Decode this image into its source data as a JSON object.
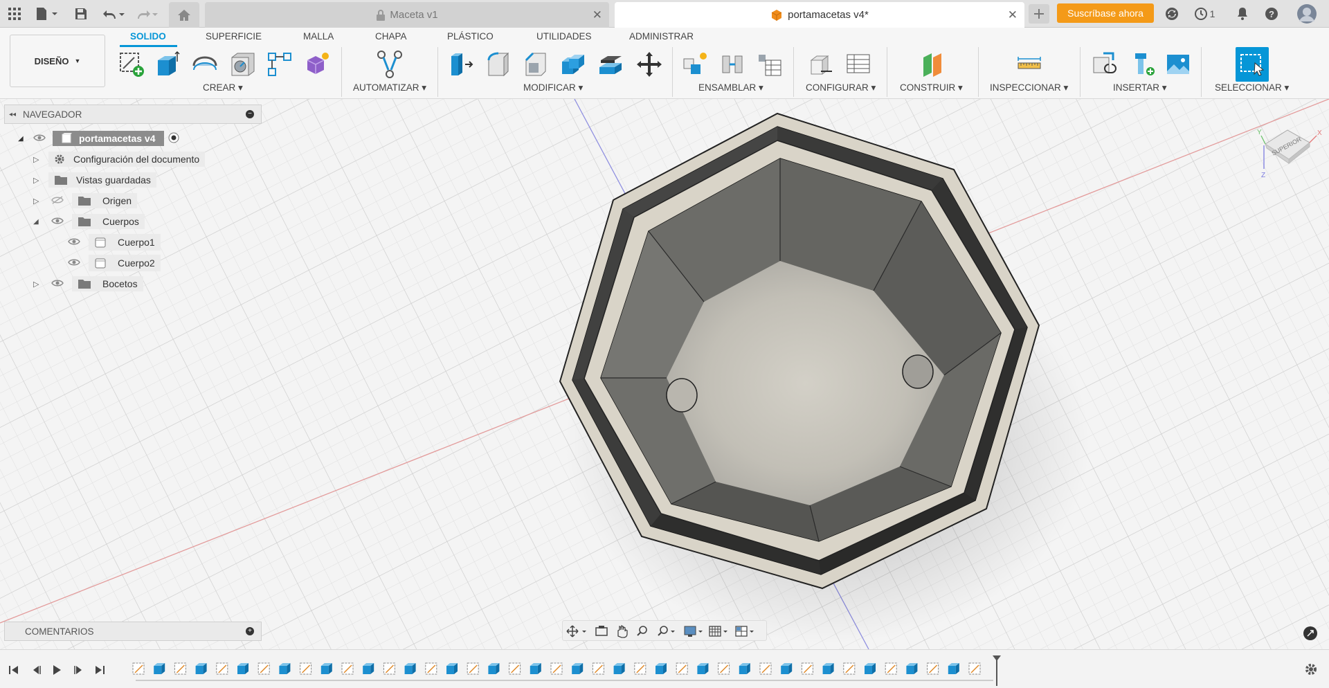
{
  "tabs": {
    "inactive": {
      "label": "Maceta v1"
    },
    "active": {
      "label": "portamacetas v4*"
    }
  },
  "header": {
    "subscribe_label": "Suscríbase ahora",
    "job_count": "1"
  },
  "toolbar": {
    "workspace_label": "DISEÑO",
    "ribbon_tabs": [
      "SOLIDO",
      "SUPERFICIE",
      "MALLA",
      "CHAPA",
      "PLÁSTICO",
      "UTILIDADES",
      "ADMINISTRAR"
    ],
    "groups": [
      "CREAR",
      "AUTOMATIZAR",
      "MODIFICAR",
      "ENSAMBLAR",
      "CONFIGURAR",
      "CONSTRUIR",
      "INSPECCIONAR",
      "INSERTAR",
      "SELECCIONAR"
    ]
  },
  "navigator": {
    "title": "NAVEGADOR",
    "root": "portamacetas v4",
    "items": [
      {
        "label": "Configuración del documento"
      },
      {
        "label": "Vistas guardadas"
      },
      {
        "label": "Origen"
      },
      {
        "label": "Cuerpos"
      },
      {
        "label": "Cuerpo1"
      },
      {
        "label": "Cuerpo2"
      },
      {
        "label": "Bocetos"
      }
    ]
  },
  "comments": {
    "title": "COMENTARIOS"
  },
  "viewcube": {
    "face": "SUPERIOR",
    "axes": [
      "X",
      "Y",
      "Z"
    ]
  },
  "colors": {
    "accent": "#0696d7",
    "subscribe": "#f49a18",
    "body_fill": "#d9d4c8",
    "inner_wall": "#6b6b66"
  }
}
